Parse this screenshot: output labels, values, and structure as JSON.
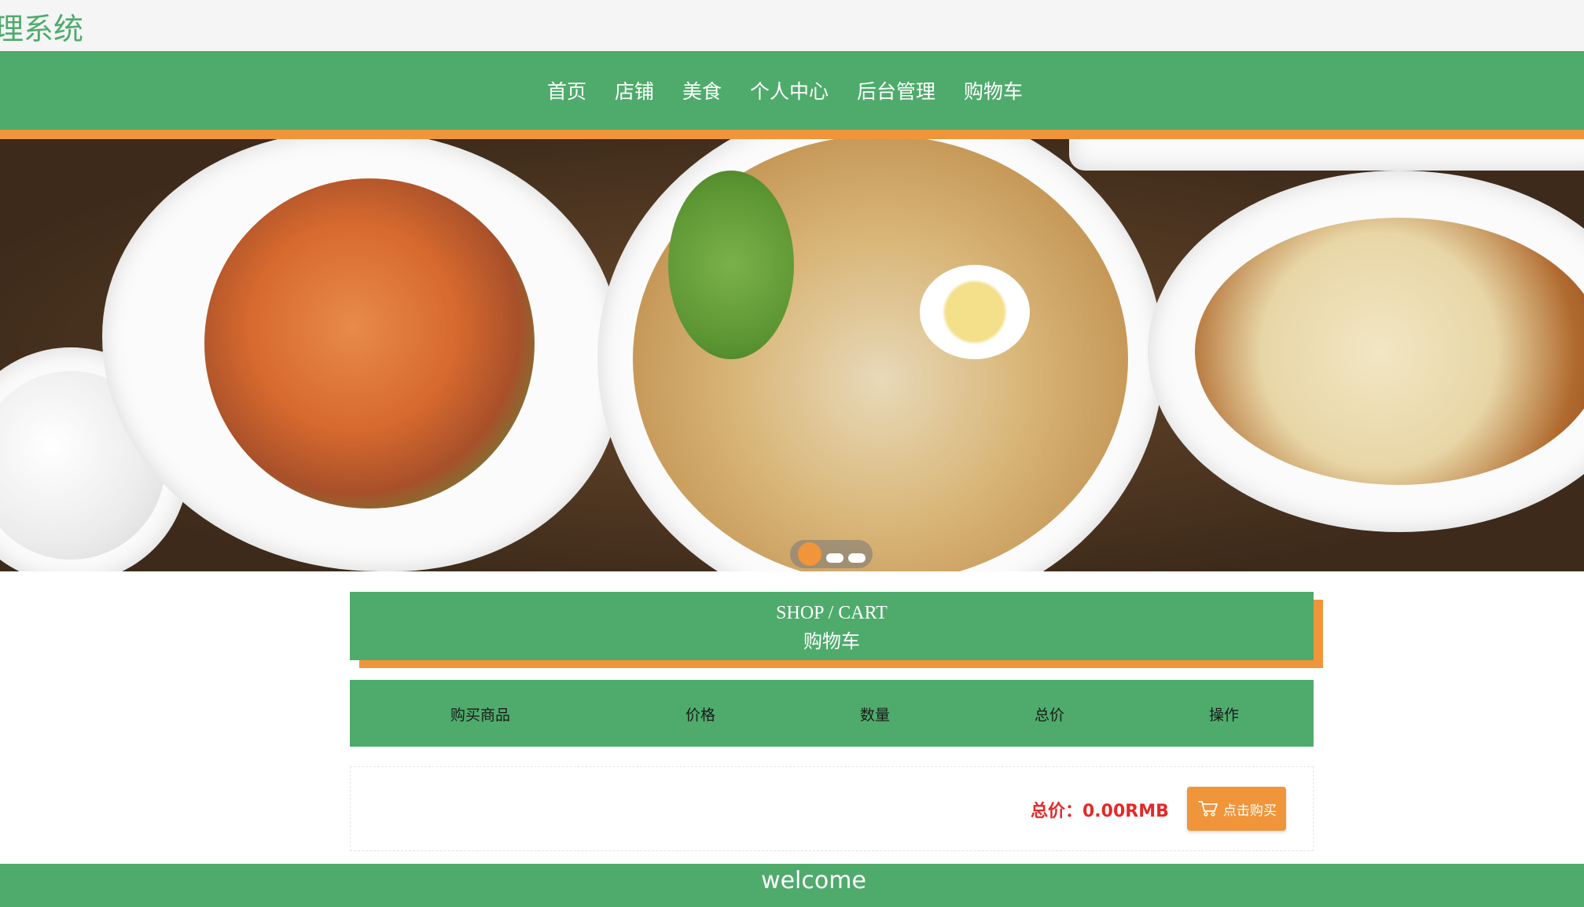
{
  "header": {
    "title": "理系统"
  },
  "nav": {
    "items": [
      {
        "label": "首页"
      },
      {
        "label": "店铺"
      },
      {
        "label": "美食"
      },
      {
        "label": "个人中心"
      },
      {
        "label": "后台管理"
      },
      {
        "label": "购物车"
      }
    ]
  },
  "banner": {
    "slide_count": 3,
    "active_slide": 1,
    "accent": "#f0953a"
  },
  "section": {
    "title_en": "SHOP / CART",
    "title_cn": "购物车"
  },
  "table": {
    "columns": [
      "购买商品",
      "价格",
      "数量",
      "总价",
      "操作"
    ],
    "rows": []
  },
  "cart": {
    "total_label": "总价：0.00RMB",
    "buy_label": "点击购买"
  },
  "footer": {
    "text": "welcome"
  },
  "colors": {
    "brand_green": "#4fab6c",
    "accent_orange": "#f0953a",
    "price_red": "#e22a2a"
  }
}
